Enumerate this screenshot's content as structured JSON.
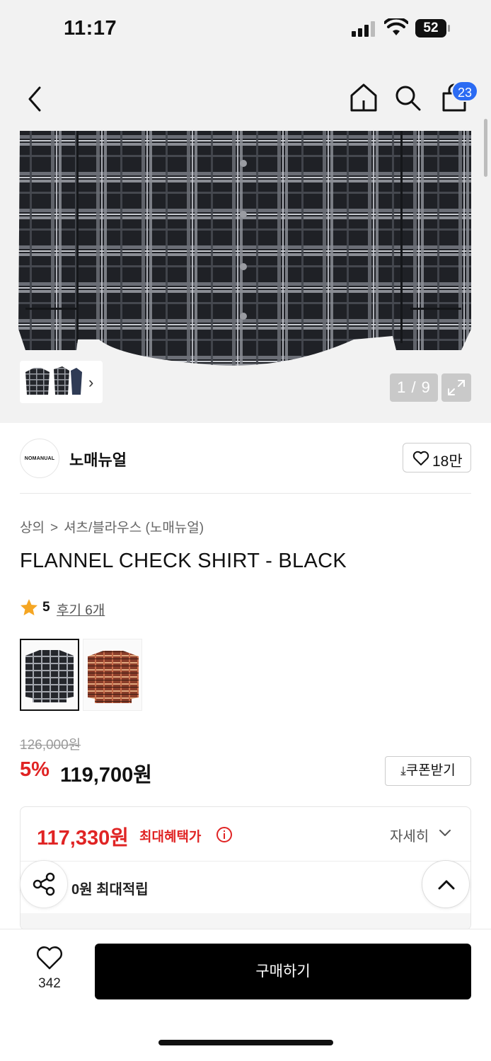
{
  "status_bar": {
    "time": "11:17",
    "battery": "52"
  },
  "header": {
    "cart_count": "23"
  },
  "gallery": {
    "counter": "1 / 9"
  },
  "brand": {
    "logo_text": "NOMANUAL",
    "name": "노매뉴얼",
    "likes": "18만"
  },
  "breadcrumb": {
    "category": "상의",
    "separator": ">",
    "subcategory": "셔츠/블라우스 (노매뉴얼)"
  },
  "product": {
    "title": "FLANNEL CHECK SHIRT - BLACK",
    "rating": "5",
    "reviews": "후기 6개",
    "original_price": "126,000원",
    "discount_rate": "5%",
    "sale_price": "119,700원"
  },
  "coupon": {
    "label": "쿠폰받기"
  },
  "benefit": {
    "max_benefit_price": "117,330원",
    "max_benefit_label": "최대혜택가",
    "detail_label": "자세히",
    "points": "0원 최대적립"
  },
  "bottom_bar": {
    "like_count": "342",
    "buy_label": "구매하기"
  },
  "colors": {
    "accent_red": "#e02424",
    "badge_blue": "#2b6bf3",
    "buy_button": "#000000"
  }
}
